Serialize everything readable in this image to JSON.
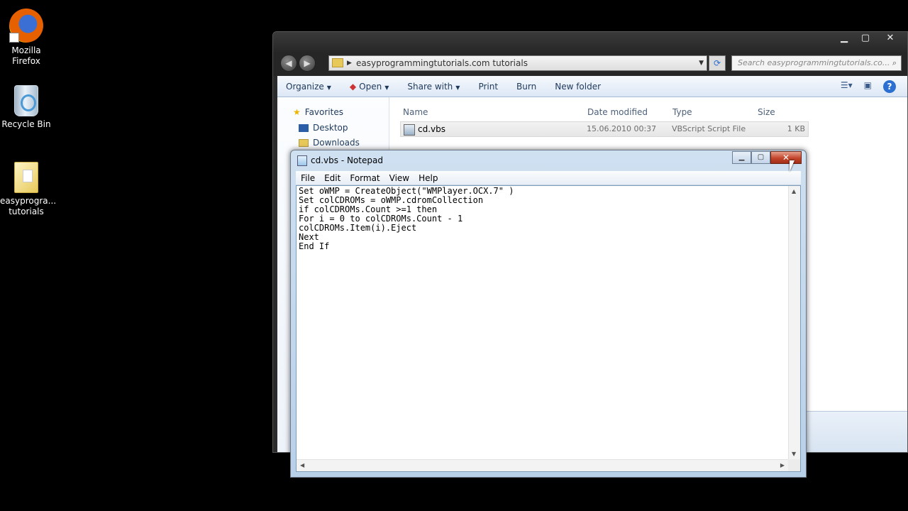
{
  "desktop": {
    "icons": [
      {
        "label": "Mozilla Firefox"
      },
      {
        "label": "Recycle Bin"
      },
      {
        "label": "easyprogra... tutorials"
      }
    ]
  },
  "explorer": {
    "caption_buttons": {
      "minimize": "▁",
      "maximize": "▢",
      "close": "✕"
    },
    "address": "easyprogrammingtutorials.com tutorials",
    "search_placeholder": "Search easyprogrammingtutorials.co...",
    "toolbar": {
      "organize": "Organize",
      "open": "Open",
      "share_with": "Share with",
      "print": "Print",
      "burn": "Burn",
      "new_folder": "New folder"
    },
    "nav": {
      "favorites": "Favorites",
      "desktop": "Desktop",
      "downloads": "Downloads"
    },
    "columns": {
      "name": "Name",
      "date_modified": "Date modified",
      "type": "Type",
      "size": "Size"
    },
    "files": [
      {
        "name": "cd.vbs",
        "date_modified": "15.06.2010 00:37",
        "type": "VBScript Script File",
        "size": "1 KB"
      }
    ]
  },
  "notepad": {
    "title": "cd.vbs - Notepad",
    "menu": [
      "File",
      "Edit",
      "Format",
      "View",
      "Help"
    ],
    "content": "Set oWMP = CreateObject(\"WMPlayer.OCX.7\" )\nSet colCDROMs = oWMP.cdromCollection\nif colCDROMs.Count >=1 then\nFor i = 0 to colCDROMs.Count - 1\ncolCDROMs.Item(i).Eject\nNext\nEnd If"
  }
}
